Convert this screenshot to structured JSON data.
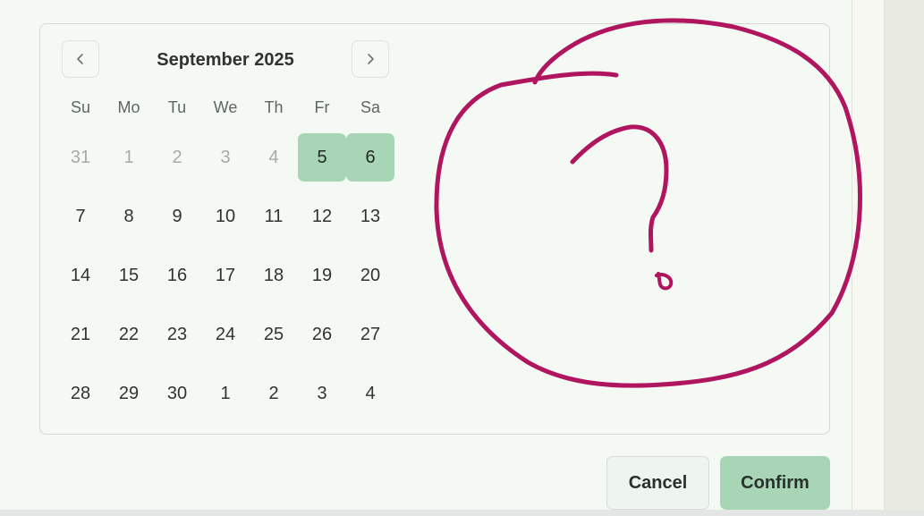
{
  "calendar": {
    "month_title": "September 2025",
    "weekdays": [
      "Su",
      "Mo",
      "Tu",
      "We",
      "Th",
      "Fr",
      "Sa"
    ],
    "weeks": [
      [
        {
          "d": "31",
          "muted": true
        },
        {
          "d": "1",
          "muted": true
        },
        {
          "d": "2",
          "muted": true
        },
        {
          "d": "3",
          "muted": true
        },
        {
          "d": "4",
          "muted": true
        },
        {
          "d": "5",
          "selected": true
        },
        {
          "d": "6",
          "selected": true
        }
      ],
      [
        {
          "d": "7"
        },
        {
          "d": "8"
        },
        {
          "d": "9"
        },
        {
          "d": "10"
        },
        {
          "d": "11"
        },
        {
          "d": "12"
        },
        {
          "d": "13"
        }
      ],
      [
        {
          "d": "14"
        },
        {
          "d": "15"
        },
        {
          "d": "16"
        },
        {
          "d": "17"
        },
        {
          "d": "18"
        },
        {
          "d": "19"
        },
        {
          "d": "20"
        }
      ],
      [
        {
          "d": "21"
        },
        {
          "d": "22"
        },
        {
          "d": "23"
        },
        {
          "d": "24"
        },
        {
          "d": "25"
        },
        {
          "d": "26"
        },
        {
          "d": "27"
        }
      ],
      [
        {
          "d": "28"
        },
        {
          "d": "29"
        },
        {
          "d": "30"
        },
        {
          "d": "1"
        },
        {
          "d": "2"
        },
        {
          "d": "3"
        },
        {
          "d": "4"
        }
      ]
    ],
    "prev_icon": "chevron-left-icon",
    "next_icon": "chevron-right-icon"
  },
  "actions": {
    "cancel_label": "Cancel",
    "confirm_label": "Confirm"
  },
  "annotation": {
    "color": "#b0155f",
    "shape": "hand-drawn circle with question mark"
  },
  "colors": {
    "selected_day": "#a8d5b5",
    "confirm_button": "#a8d5b5",
    "page_background": "#f5f9f3"
  }
}
